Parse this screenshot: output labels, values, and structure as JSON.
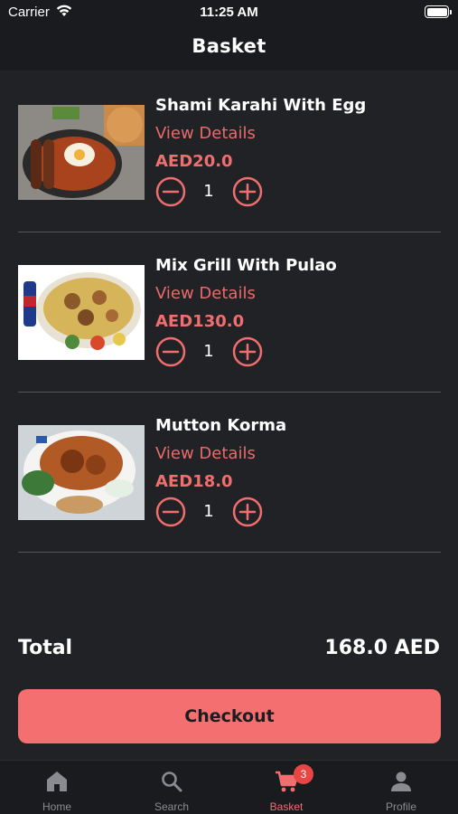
{
  "status_bar": {
    "carrier": "Carrier",
    "time": "11:25 AM"
  },
  "header": {
    "title": "Basket"
  },
  "items": [
    {
      "name": "Shami Karahi With Egg",
      "details_label": "View Details",
      "price": "AED20.0",
      "quantity": "1"
    },
    {
      "name": "Mix Grill With Pulao",
      "details_label": "View Details",
      "price": "AED130.0",
      "quantity": "1"
    },
    {
      "name": "Mutton Korma",
      "details_label": "View Details",
      "price": "AED18.0",
      "quantity": "1"
    }
  ],
  "summary": {
    "total_label": "Total",
    "total_value": "168.0 AED"
  },
  "checkout": {
    "label": "Checkout"
  },
  "tab_bar": {
    "tabs": [
      {
        "label": "Home",
        "icon": "home-icon"
      },
      {
        "label": "Search",
        "icon": "search-icon"
      },
      {
        "label": "Basket",
        "icon": "cart-icon",
        "badge": "3",
        "active": true
      },
      {
        "label": "Profile",
        "icon": "person-icon"
      }
    ]
  },
  "colors": {
    "accent": "#f46f6f",
    "background": "#212226",
    "bar": "#1a1b1e",
    "badge": "#e84545"
  }
}
